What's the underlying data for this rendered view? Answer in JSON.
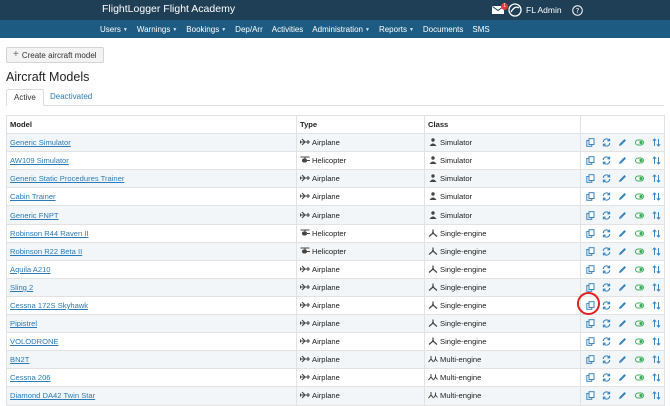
{
  "app": {
    "title": "FlightLogger Flight Academy",
    "user": "FL Admin",
    "notification_count": "1"
  },
  "nav": [
    {
      "label": "Users",
      "caret": true
    },
    {
      "label": "Warnings",
      "caret": true
    },
    {
      "label": "Bookings",
      "caret": true
    },
    {
      "label": "Dep/Arr",
      "caret": false
    },
    {
      "label": "Activities",
      "caret": false
    },
    {
      "label": "Administration",
      "caret": true
    },
    {
      "label": "Reports",
      "caret": true
    },
    {
      "label": "Documents",
      "caret": false
    },
    {
      "label": "SMS",
      "caret": false
    }
  ],
  "toolbar": {
    "create_label": "Create aircraft model"
  },
  "page": {
    "title": "Aircraft Models"
  },
  "tabs": {
    "active": "Active",
    "inactive": "Deactivated"
  },
  "table": {
    "columns": [
      "Model",
      "Type",
      "Class",
      ""
    ],
    "rows": [
      {
        "model": "Generic Simulator",
        "type": "Airplane",
        "type_icon": "airplane-icon",
        "class": "Simulator",
        "class_icon": "simulator-icon"
      },
      {
        "model": "AW109 Simulator",
        "type": "Helicopter",
        "type_icon": "helicopter-icon",
        "class": "Simulator",
        "class_icon": "simulator-icon"
      },
      {
        "model": "Generic Static Procedures Trainer",
        "type": "Airplane",
        "type_icon": "airplane-icon",
        "class": "Simulator",
        "class_icon": "simulator-icon"
      },
      {
        "model": "Cabin Trainer",
        "type": "Airplane",
        "type_icon": "airplane-icon",
        "class": "Simulator",
        "class_icon": "simulator-icon"
      },
      {
        "model": "Generic FNPT",
        "type": "Airplane",
        "type_icon": "airplane-icon",
        "class": "Simulator",
        "class_icon": "simulator-icon"
      },
      {
        "model": "Robinson R44 Raven II",
        "type": "Helicopter",
        "type_icon": "helicopter-icon",
        "class": "Single-engine",
        "class_icon": "single-engine-icon"
      },
      {
        "model": "Robinson R22 Beta II",
        "type": "Helicopter",
        "type_icon": "helicopter-icon",
        "class": "Single-engine",
        "class_icon": "single-engine-icon"
      },
      {
        "model": "Aquila A210",
        "type": "Airplane",
        "type_icon": "airplane-icon",
        "class": "Single-engine",
        "class_icon": "single-engine-icon"
      },
      {
        "model": "Sling 2",
        "type": "Airplane",
        "type_icon": "airplane-icon",
        "class": "Single-engine",
        "class_icon": "single-engine-icon"
      },
      {
        "model": "Cessna 172S Skyhawk",
        "type": "Airplane",
        "type_icon": "airplane-icon",
        "class": "Single-engine",
        "class_icon": "single-engine-icon"
      },
      {
        "model": "Pipistrel",
        "type": "Airplane",
        "type_icon": "airplane-icon",
        "class": "Single-engine",
        "class_icon": "single-engine-icon"
      },
      {
        "model": "VOLODRONE",
        "type": "Airplane",
        "type_icon": "airplane-icon",
        "class": "Single-engine",
        "class_icon": "single-engine-icon"
      },
      {
        "model": "BN2T",
        "type": "Airplane",
        "type_icon": "airplane-icon",
        "class": "Multi-engine",
        "class_icon": "multi-engine-icon"
      },
      {
        "model": "Cessna 206",
        "type": "Airplane",
        "type_icon": "airplane-icon",
        "class": "Multi-engine",
        "class_icon": "multi-engine-icon"
      },
      {
        "model": "Diamond DA42 Twin Star",
        "type": "Airplane",
        "type_icon": "airplane-icon",
        "class": "Multi-engine",
        "class_icon": "multi-engine-icon"
      }
    ],
    "row_actions": [
      "copy-icon",
      "sync-icon",
      "pencil-icon",
      "toggle-icon",
      "sort-arrows-icon"
    ]
  },
  "colors": {
    "topbar": "#1f3f56",
    "navbar": "#1e5b82",
    "link": "#2b7bb9",
    "highlight": "#e02020"
  }
}
